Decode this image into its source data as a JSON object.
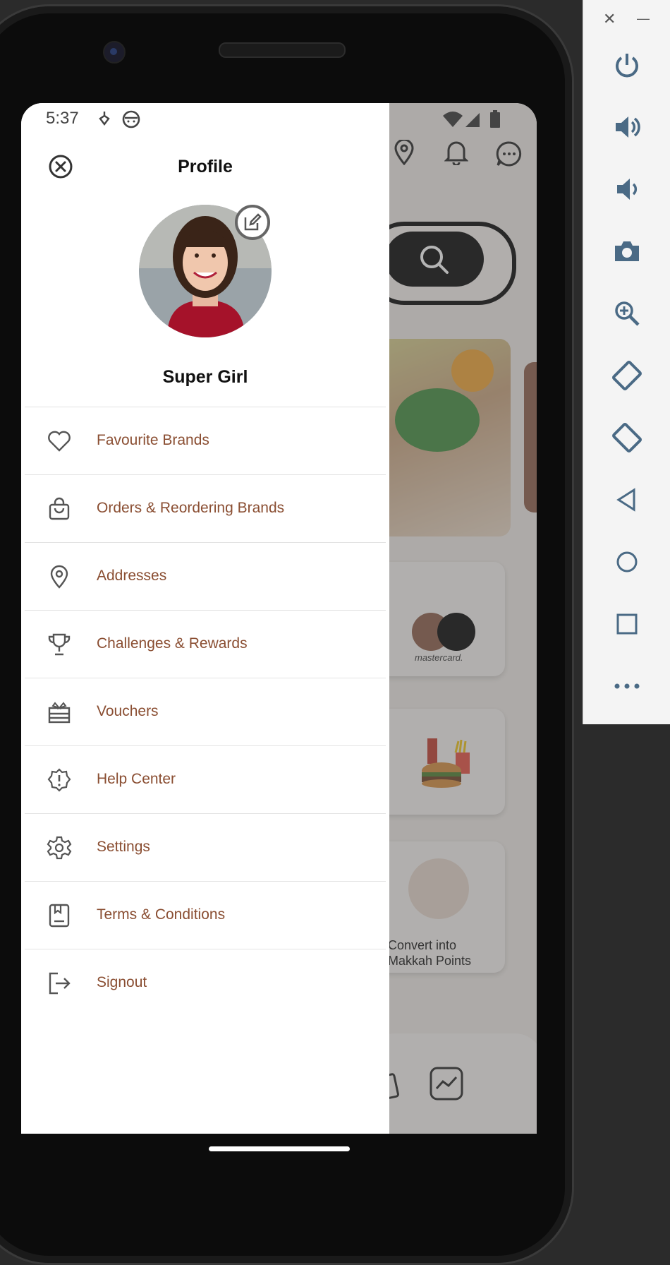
{
  "status_bar": {
    "time": "5:37"
  },
  "drawer": {
    "title": "Profile",
    "user_name": "Super Girl",
    "menu": [
      {
        "label": "Favourite Brands",
        "icon": "heart-icon"
      },
      {
        "label": "Orders & Reordering Brands",
        "icon": "shopping-bag-icon"
      },
      {
        "label": "Addresses",
        "icon": "map-pin-icon"
      },
      {
        "label": "Challenges & Rewards",
        "icon": "trophy-icon"
      },
      {
        "label": "Vouchers",
        "icon": "gift-card-icon"
      },
      {
        "label": "Help Center",
        "icon": "help-badge-icon"
      },
      {
        "label": "Settings",
        "icon": "gear-icon"
      },
      {
        "label": "Terms & Conditions",
        "icon": "document-icon"
      },
      {
        "label": "Signout",
        "icon": "logout-icon"
      }
    ]
  },
  "background_app": {
    "card_payment_text": "mastercard.",
    "convert_text_line1": "Convert into",
    "convert_text_line2": "Makkah Points"
  },
  "emulator_panel": {
    "close": "✕",
    "minimize": "—"
  },
  "colors": {
    "menu_text": "#8a4e32",
    "accent_brown": "#8a5a45"
  }
}
